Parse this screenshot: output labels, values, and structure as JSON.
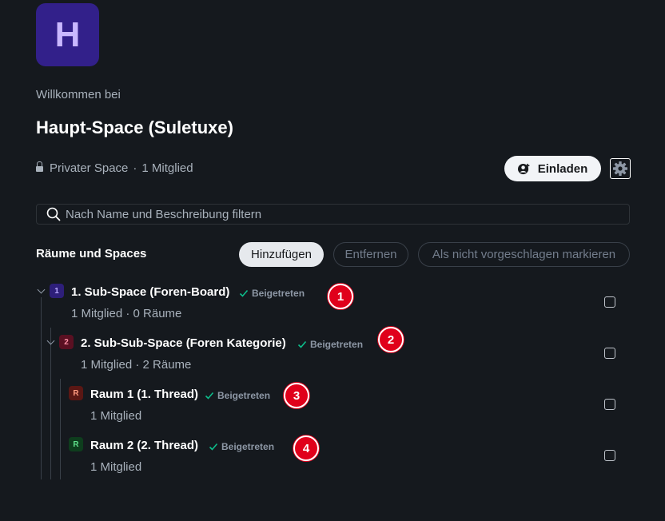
{
  "space": {
    "avatar_letter": "H",
    "welcome": "Willkommen bei",
    "title": "Haupt-Space (Suletuxe)",
    "privacy": "Privater Space",
    "separator": "·",
    "members": "1 Mitglied",
    "avatar_color": "#32208a"
  },
  "actions": {
    "invite_label": "Einladen",
    "settings_icon": "gear-icon",
    "invite_icon": "person-add-icon"
  },
  "search": {
    "placeholder": "Nach Name und Beschreibung filtern",
    "value": ""
  },
  "rooms_section": {
    "title": "Räume und Spaces",
    "add_label": "Hinzufügen",
    "remove_label": "Entfernen",
    "unsuggest_label": "Als nicht vorgeschlagen markieren"
  },
  "rows": [
    {
      "badge": "1",
      "badge_bg": "#2e1f7a",
      "badge_fg": "#b9a8ff",
      "title": "1. Sub-Space (Foren-Board)",
      "status": "Beigetreten",
      "sub": "1 Mitglied · 0 Räume",
      "marker": "1"
    },
    {
      "badge": "2",
      "badge_bg": "#5a1022",
      "badge_fg": "#ff8fa5",
      "title": "2. Sub-Sub-Space (Foren Kategorie)",
      "status": "Beigetreten",
      "sub": "1 Mitglied · 2 Räume",
      "marker": "2"
    },
    {
      "badge": "R",
      "badge_bg": "#5a1714",
      "badge_fg": "#ff9a80",
      "title": "Raum 1 (1. Thread)",
      "status": "Beigetreten",
      "sub": "1 Mitglied",
      "marker": "3"
    },
    {
      "badge": "R",
      "badge_bg": "#0e3d1d",
      "badge_fg": "#5fe08a",
      "title": "Raum 2 (2. Thread)",
      "status": "Beigetreten",
      "sub": "1 Mitglied",
      "marker": "4"
    }
  ],
  "colors": {
    "background": "#15191e",
    "joined_check": "#0dbd8b",
    "marker_red": "#e0001b"
  }
}
